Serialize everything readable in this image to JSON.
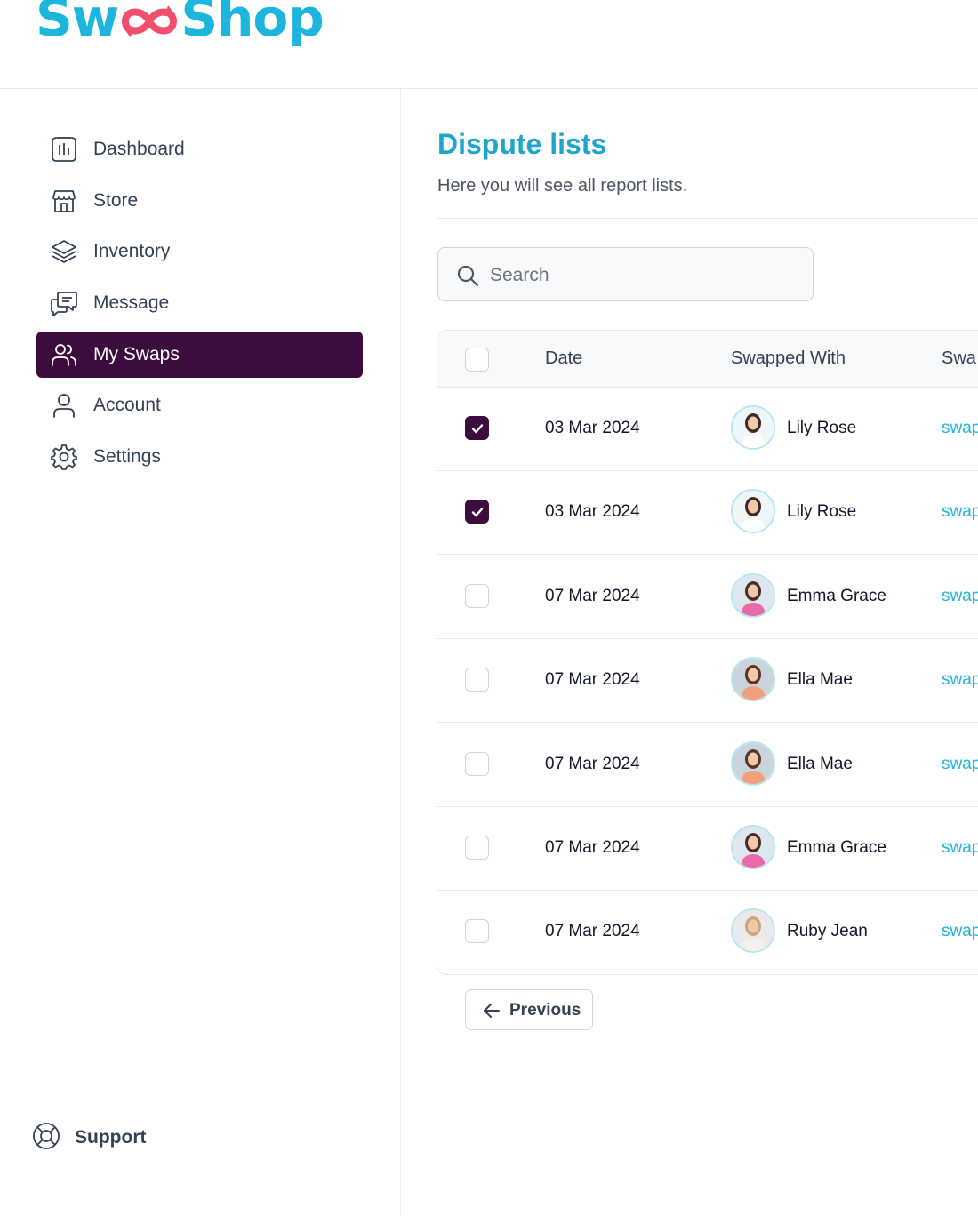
{
  "app": {
    "logo_left": "Sw",
    "logo_right": "Shop",
    "brand_color": "#1cb5de",
    "accent_color": "#f0506e"
  },
  "sidebar": {
    "items": [
      {
        "label": "Dashboard",
        "icon": "bar-chart-icon",
        "active": false
      },
      {
        "label": "Store",
        "icon": "store-icon",
        "active": false
      },
      {
        "label": "Inventory",
        "icon": "layers-icon",
        "active": false
      },
      {
        "label": "Message",
        "icon": "chat-icon",
        "active": false
      },
      {
        "label": "My Swaps",
        "icon": "users-icon",
        "active": true
      },
      {
        "label": "Account",
        "icon": "user-icon",
        "active": false
      },
      {
        "label": "Settings",
        "icon": "gear-icon",
        "active": false
      }
    ],
    "support_label": "Support",
    "active_color": "#3d0c3f"
  },
  "main": {
    "title": "Dispute lists",
    "subtitle": "Here you will see all report lists.",
    "search": {
      "placeholder": "Search",
      "value": ""
    },
    "table": {
      "headers": [
        "Date",
        "Swapped With",
        "Swa"
      ],
      "rows": [
        {
          "checked": true,
          "date": "03 Mar 2024",
          "name": "Lily Rose",
          "swap": "swap"
        },
        {
          "checked": true,
          "date": "03 Mar 2024",
          "name": "Lily Rose",
          "swap": "swap"
        },
        {
          "checked": false,
          "date": "07 Mar 2024",
          "name": "Emma Grace",
          "swap": "swap"
        },
        {
          "checked": false,
          "date": "07 Mar 2024",
          "name": "Ella Mae",
          "swap": "swap"
        },
        {
          "checked": false,
          "date": "07 Mar 2024",
          "name": "Ella Mae",
          "swap": "swap"
        },
        {
          "checked": false,
          "date": "07 Mar 2024",
          "name": "Emma Grace",
          "swap": "swap"
        },
        {
          "checked": false,
          "date": "07 Mar 2024",
          "name": "Ruby Jean",
          "swap": "swap"
        }
      ]
    },
    "pagination": {
      "previous_label": "Previous"
    }
  }
}
